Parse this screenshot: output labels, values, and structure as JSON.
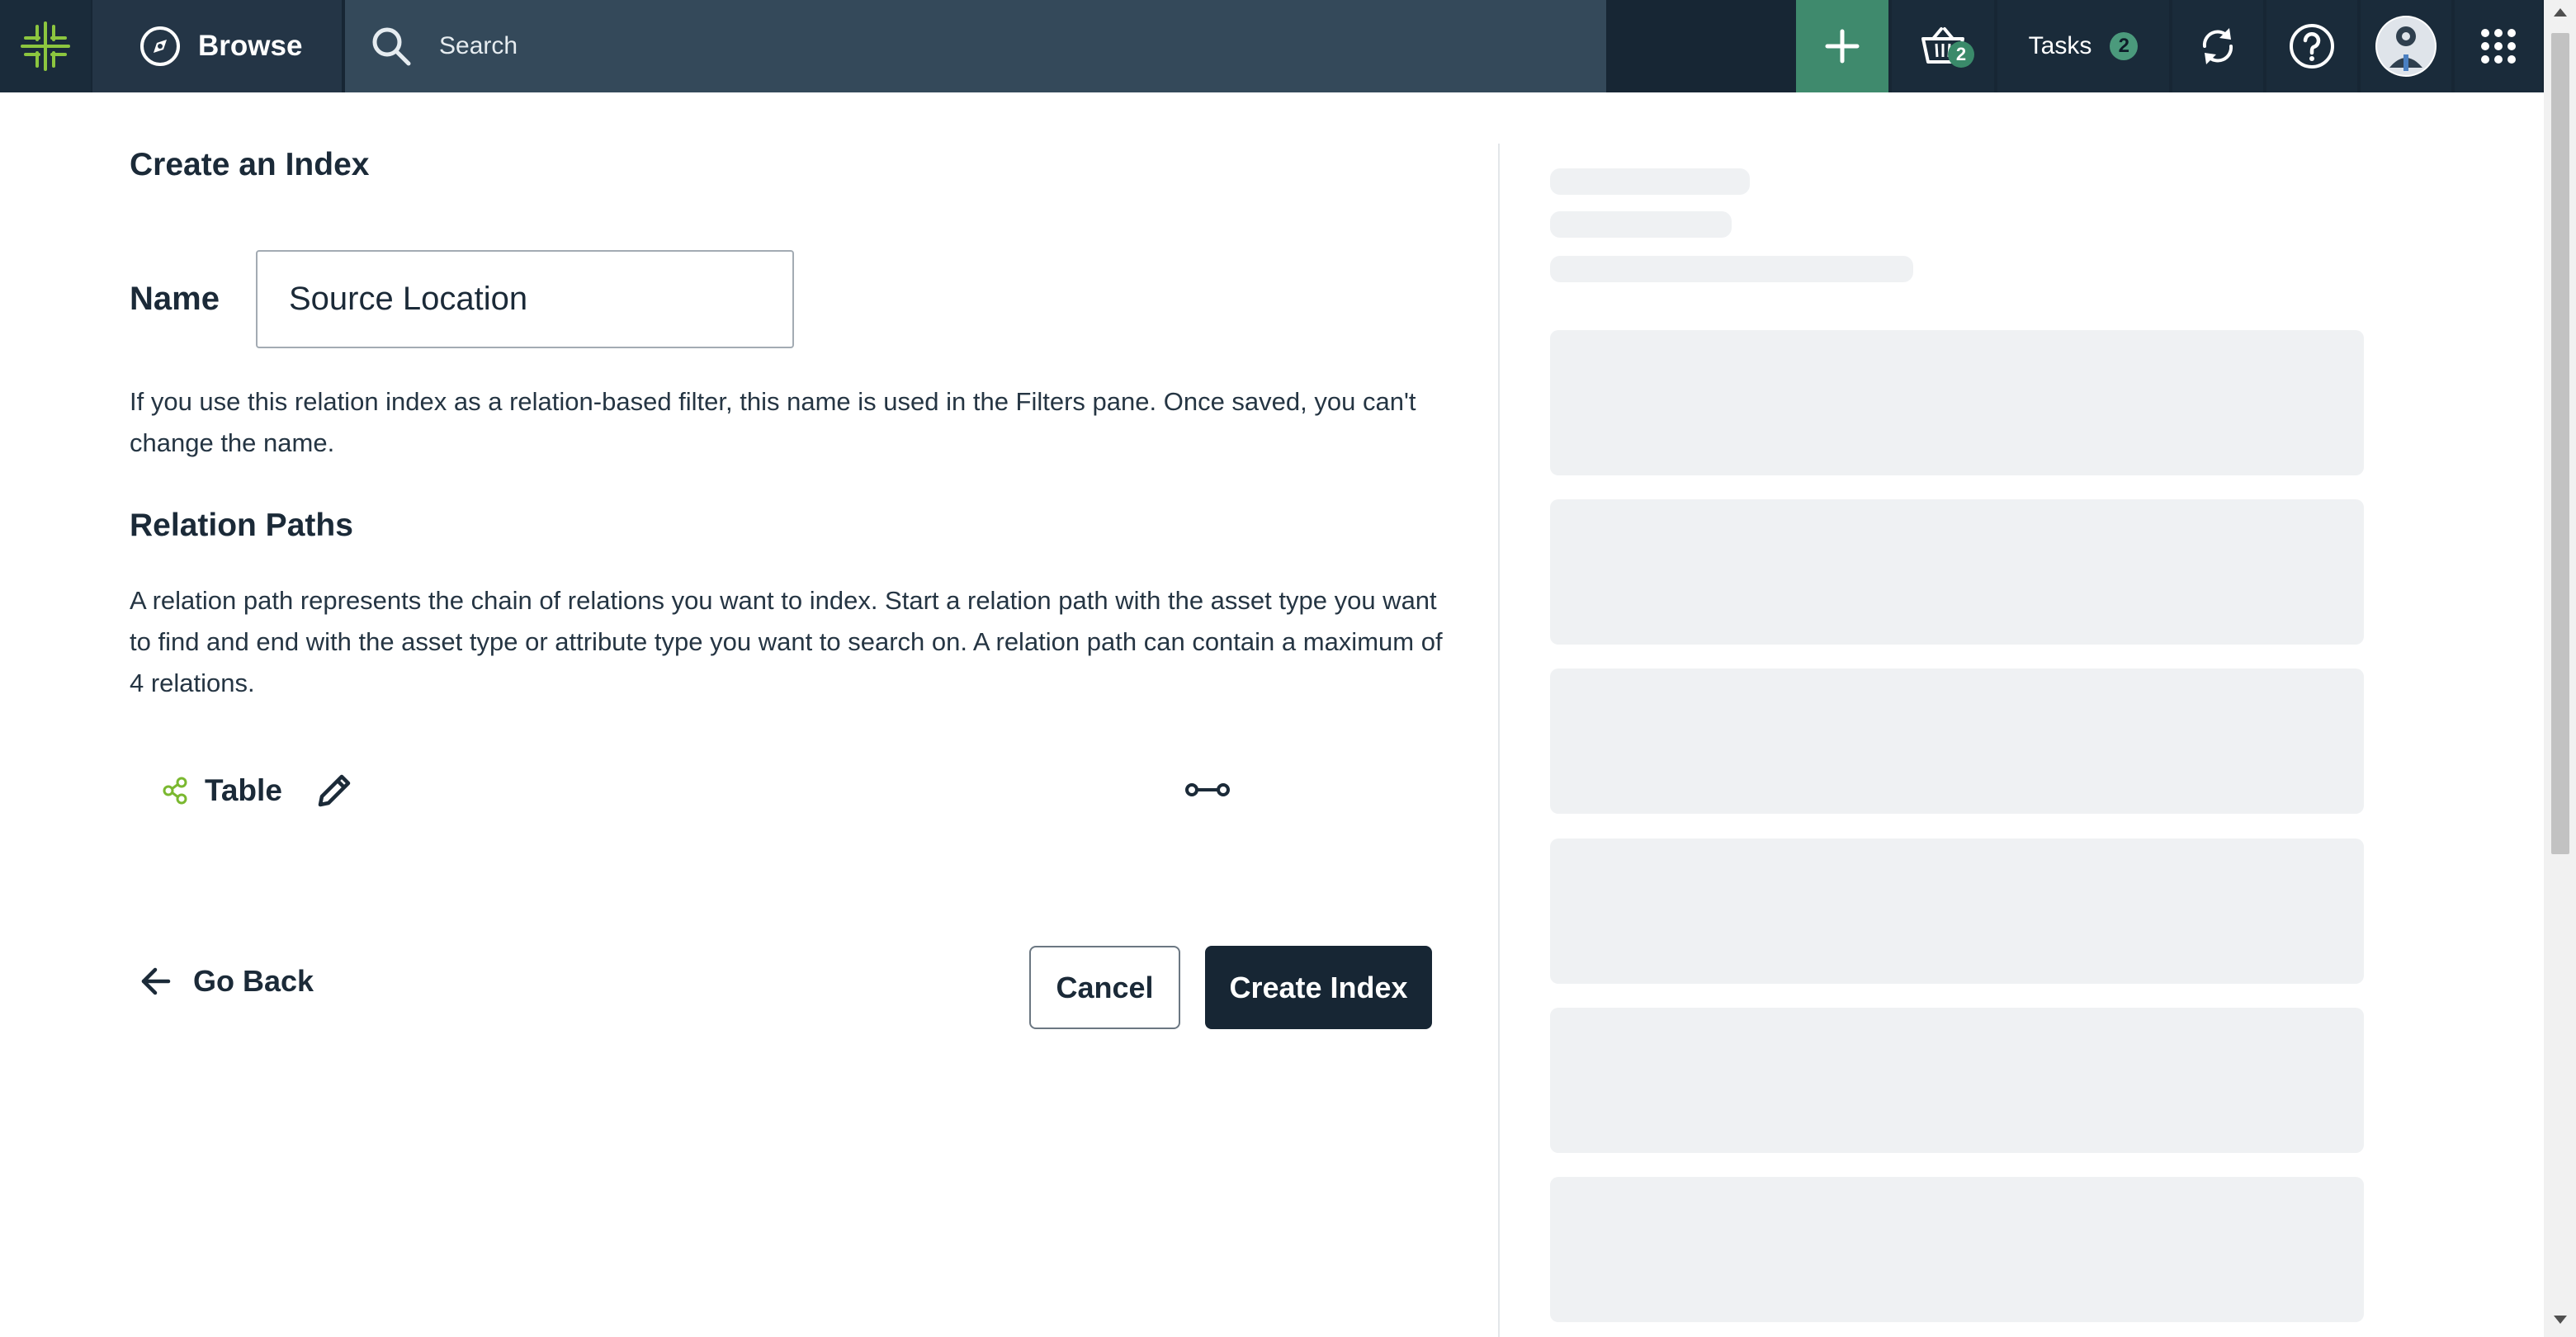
{
  "header": {
    "browse_label": "Browse",
    "search_placeholder": "Search",
    "basket_count": "2",
    "tasks_label": "Tasks",
    "tasks_count": "2"
  },
  "form": {
    "title": "Create an Index",
    "name_label": "Name",
    "name_value": "Source Location",
    "name_help": "If you use this relation index as a relation-based filter, this name is used in the Filters pane. Once saved, you can't change the name.",
    "section_title": "Relation Paths",
    "section_desc": "A relation path represents the chain of relations you want to index. Start a relation path with the asset type you want to find and end with the asset type or attribute type you want to search on. A relation path can contain a maximum of 4 relations.",
    "path_start_label": "Table"
  },
  "actions": {
    "go_back": "Go Back",
    "cancel": "Cancel",
    "create": "Create Index"
  },
  "colors": {
    "topbar": "#172634",
    "accent_green": "#3f8a6d",
    "logo_green": "#8cc63f",
    "primary_button": "#172634",
    "skeleton": "#eff1f3"
  },
  "icons": [
    "logo-icon",
    "compass-icon",
    "search-icon",
    "plus-icon",
    "basket-icon",
    "sync-icon",
    "help-icon",
    "avatar",
    "apps-grid-icon",
    "asset-type-icon",
    "pencil-icon",
    "relation-link-icon",
    "arrow-left-icon"
  ]
}
